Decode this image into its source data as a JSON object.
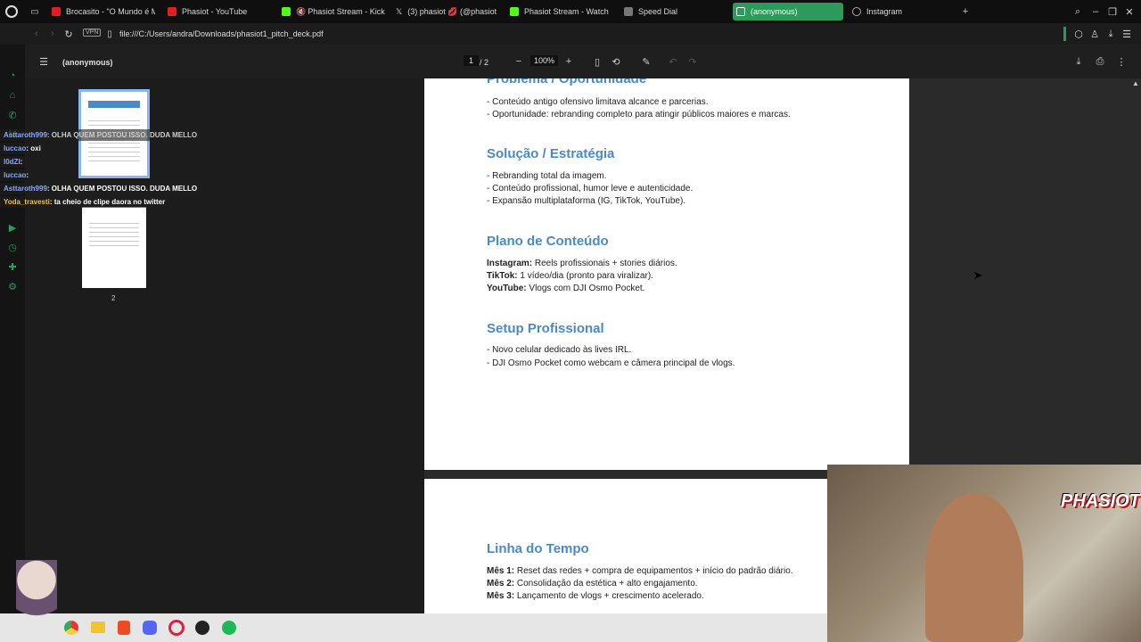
{
  "tabs": [
    {
      "label": "Brocasito - \"O Mundo é M",
      "color": "#e02020"
    },
    {
      "label": "Phasiot - YouTube",
      "color": "#e02020"
    },
    {
      "label": "Phasiot Stream - Kick",
      "color": "#53fc18",
      "audio": "🔇"
    },
    {
      "label": "(3) phasiot 💋 (@phasiot",
      "color": "#ffffff",
      "prefix": "𝕏"
    },
    {
      "label": "Phasiot Stream - Watch L",
      "color": "#53fc18"
    },
    {
      "label": "Speed Dial",
      "color": "#888888"
    },
    {
      "label": "(anonymous)",
      "color": "#ffffff"
    },
    {
      "label": "Instagram",
      "color": "#aaaaaa"
    }
  ],
  "address": {
    "vpn": "VPN",
    "url": "file:///C:/Users/andra/Downloads/phasiot1_pitch_deck.pdf"
  },
  "pdf": {
    "title": "(anonymous)",
    "page_current": "1",
    "page_total": "/ 2",
    "zoom": "100%"
  },
  "thumbs": {
    "page2": "2"
  },
  "chat": [
    {
      "user": "Asttaroth999",
      "msg": ": OLHA QUEM POSTOU ISSO. DUDA MELLO"
    },
    {
      "user": "luccao",
      "msg": ": oxi"
    },
    {
      "user": "l0dZI",
      "msg": ":"
    },
    {
      "user": "luccao",
      "msg": ":"
    },
    {
      "user": "Asttaroth999",
      "msg": ": OLHA QUEM POSTOU ISSO. DUDA MELLO"
    },
    {
      "user": "Yoda_travesti",
      "msg": ": ta cheio de clipe daora no twitter"
    }
  ],
  "page1": {
    "h_problem": "Problema / Oportunidade",
    "problem": [
      "- Conteúdo antigo ofensivo limitava alcance e parcerias.",
      "- Oportunidade: rebranding completo para atingir públicos maiores e marcas."
    ],
    "h_solution": "Solução / Estratégia",
    "solution": [
      "- Rebranding total da imagem.",
      "- Conteúdo profissional, humor leve e autenticidade.",
      "- Expansão multiplataforma (IG, TikTok, YouTube)."
    ],
    "h_plan": "Plano de Conteúdo",
    "plan": [
      {
        "k": "Instagram:",
        "v": " Reels profissionais + stories diários."
      },
      {
        "k": "TikTok:",
        "v": " 1 vídeo/dia (pronto para viralizar)."
      },
      {
        "k": "YouTube:",
        "v": " Vlogs com DJI Osmo Pocket."
      }
    ],
    "h_setup": "Setup Profissional",
    "setup": [
      "- Novo celular dedicado às lives IRL.",
      "- DJI Osmo Pocket como webcam e câmera principal de vlogs."
    ]
  },
  "page2": {
    "h_timeline": "Linha do Tempo",
    "timeline": [
      {
        "k": "Mês 1:",
        "v": " Reset das redes + compra de equipamentos + início do padrão diário."
      },
      {
        "k": "Mês 2:",
        "v": " Consolidação da estética + alto engajamento."
      },
      {
        "k": "Mês 3:",
        "v": " Lançamento de vlogs + crescimento acelerado."
      }
    ]
  },
  "overlay": {
    "logo": "PHASIOT"
  }
}
